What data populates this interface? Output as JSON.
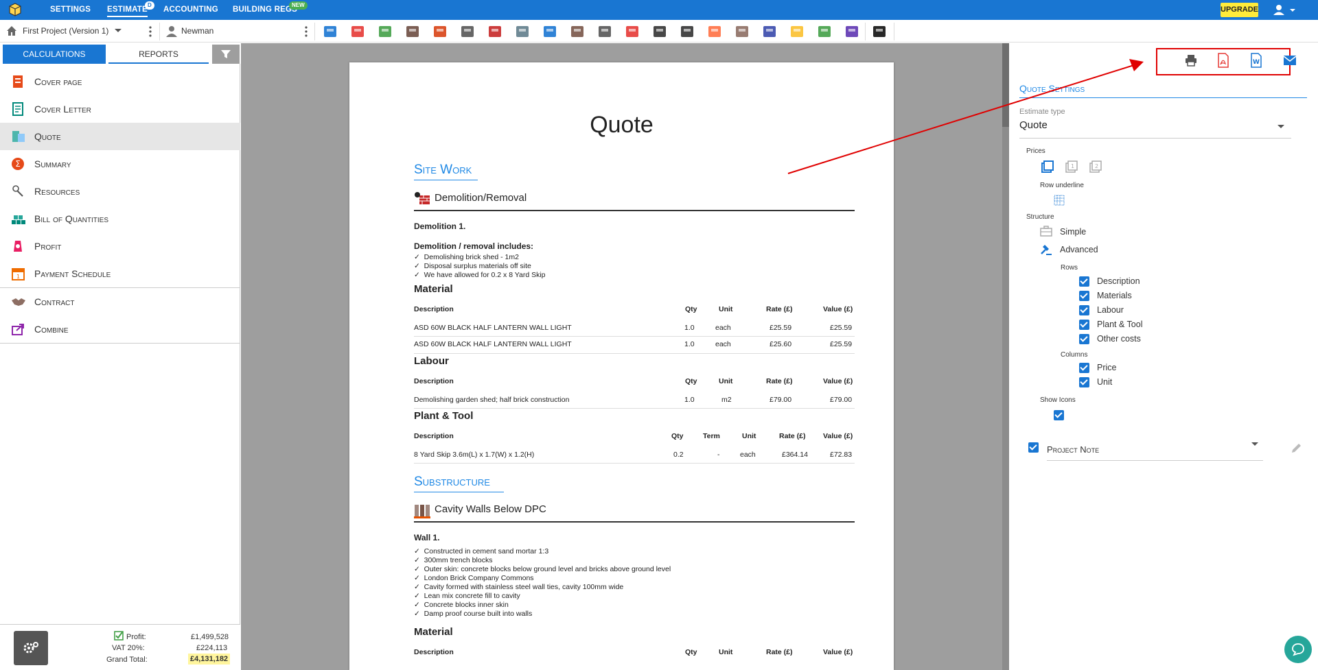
{
  "topnav": {
    "settings": "SETTINGS",
    "estimate": "ESTIMATE",
    "estimate_badge": "D",
    "accounting": "ACCOUNTING",
    "building_regs": "BUILDING REGS",
    "building_regs_badge": "NEW",
    "upgrade": "UPGRADE"
  },
  "toolbar": {
    "project": "First Project (Version 1)",
    "client": "Newman"
  },
  "left": {
    "tabs": {
      "calculations": "CALCULATIONS",
      "reports": "REPORTS"
    },
    "menu": [
      "Cover page",
      "Cover Letter",
      "Quote",
      "Summary",
      "Resources",
      "Bill of Quantities",
      "Profit",
      "Payment Schedule",
      "Contract",
      "Combine"
    ],
    "footer": {
      "profit_label": "Profit:",
      "profit_value": "£1,499,528",
      "vat_label": "VAT 20%:",
      "vat_value": "£224,113",
      "total_label": "Grand Total:",
      "total_value": "£4,131,182"
    }
  },
  "doc": {
    "title": "Quote",
    "sec1": "Site Work",
    "sec1_sub": "Demolition/Removal",
    "dem_name": "Demolition 1.",
    "dem_inc": "Demolition / removal includes:",
    "dem_items": [
      "Demolishing brick shed - 1m2",
      "Disposal surplus materials off site",
      "We have allowed for 0.2 x 8 Yard Skip"
    ],
    "material": "Material",
    "labour": "Labour",
    "plant": "Plant & Tool",
    "cols": {
      "desc": "Description",
      "qty": "Qty",
      "unit": "Unit",
      "rate": "Rate (£)",
      "value": "Value (£)",
      "term": "Term"
    },
    "mat_rows": [
      [
        "ASD 60W BLACK HALF LANTERN WALL LIGHT",
        "1.0",
        "each",
        "£25.59",
        "£25.59"
      ],
      [
        "ASD 60W BLACK HALF LANTERN WALL LIGHT",
        "1.0",
        "each",
        "£25.60",
        "£25.59"
      ]
    ],
    "lab_rows": [
      [
        "Demolishing garden shed; half brick construction",
        "1.0",
        "m2",
        "£79.00",
        "£79.00"
      ]
    ],
    "plant_rows": [
      [
        "8 Yard Skip 3.6m(L) x 1.7(W) x 1.2(H)",
        "0.2",
        "-",
        "each",
        "£364.14",
        "£72.83"
      ]
    ],
    "sec2": "Substructure",
    "sec2_sub": "Cavity Walls Below DPC",
    "wall_name": "Wall 1.",
    "wall_items": [
      "Constructed in cement sand mortar 1:3",
      "300mm trench blocks",
      "Outer skin: concrete blocks below ground level and bricks above ground level",
      "London Brick Company Commons",
      "Cavity formed with stainless steel wall ties, cavity 100mm wide",
      "Lean mix concrete fill to cavity",
      "Concrete blocks inner skin",
      "Damp proof course built into walls"
    ],
    "mat2": "Material",
    "check": "✓"
  },
  "right": {
    "heading": "Quote Settings",
    "estimate_type_label": "Estimate type",
    "estimate_type": "Quote",
    "prices": "Prices",
    "row_underline": "Row underline",
    "structure": "Structure",
    "simple": "Simple",
    "advanced": "Advanced",
    "rows": "Rows",
    "row_items": [
      "Description",
      "Materials",
      "Labour",
      "Plant & Tool",
      "Other costs"
    ],
    "columns": "Columns",
    "col_items": [
      "Price",
      "Unit"
    ],
    "show_icons": "Show Icons",
    "project_note": "Project Note"
  },
  "colors": {
    "primary": "#1976d2",
    "accent_red": "#e53935",
    "upgrade": "#ffeb3b"
  }
}
